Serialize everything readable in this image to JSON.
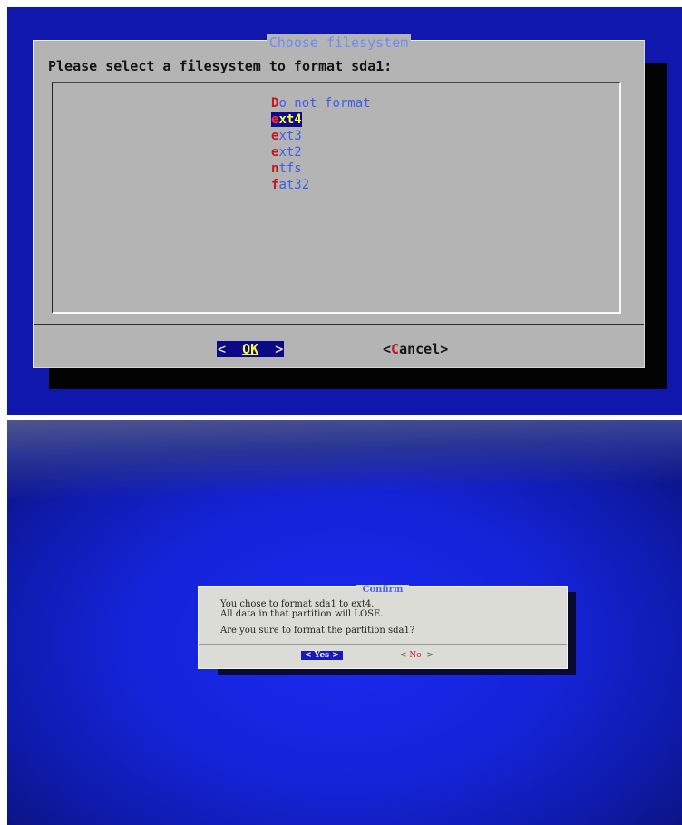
{
  "top": {
    "dialog_title": "Choose filesystem",
    "prompt": "Please select a filesystem to format sda1:",
    "options": [
      {
        "hotkey": "D",
        "rest": "o not format",
        "selected": false
      },
      {
        "hotkey": "e",
        "rest": "xt4",
        "selected": true
      },
      {
        "hotkey": "e",
        "rest": "xt3",
        "selected": false
      },
      {
        "hotkey": "e",
        "rest": "xt2",
        "selected": false
      },
      {
        "hotkey": "n",
        "rest": "tfs",
        "selected": false
      },
      {
        "hotkey": "f",
        "rest": "at32",
        "selected": false
      }
    ],
    "ok_button": {
      "pre": "<  ",
      "hotkey": "O",
      "rest": "K",
      "post": "  >"
    },
    "cancel_button": {
      "pre": "<",
      "hotkey": "C",
      "rest": "ancel>"
    }
  },
  "bottom": {
    "dialog_title": "Confirm",
    "line1": "You chose to format sda1 to ext4.",
    "line2": "All data in that partition will LOSE.",
    "line3": "Are you sure to format the partition sda1?",
    "yes_button": "< Yes >",
    "no_button": {
      "pre": "< ",
      "hotkey": "N",
      "rest": "o",
      "post": "  >"
    }
  },
  "colors": {
    "screen_blue": "#0f17ad",
    "dialog_gray": "#b4b4b4",
    "selection": "#0b0b8c",
    "hotkey_red": "#c8161e",
    "title_blue": "#6e8cf2"
  }
}
